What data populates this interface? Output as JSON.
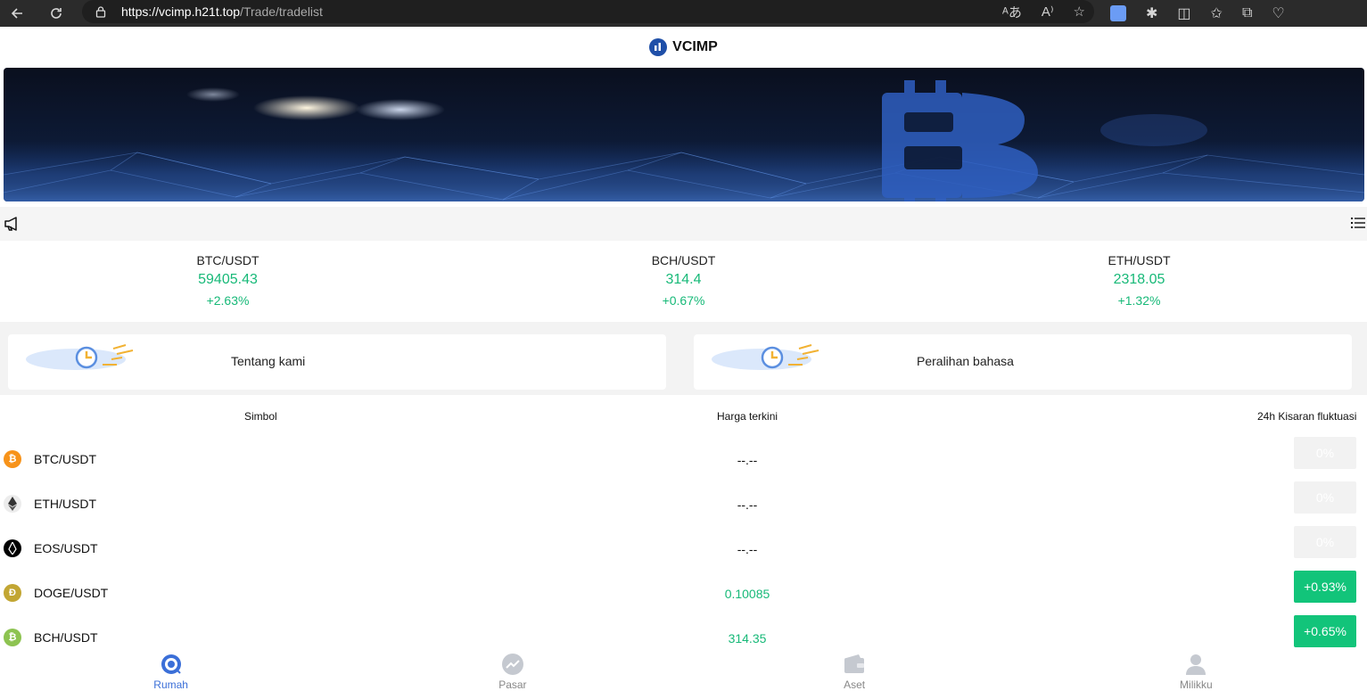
{
  "browser": {
    "url_host": "https://vcimp.h21t.top",
    "url_path": "/Trade/tradelist"
  },
  "header": {
    "title": "VCIMP"
  },
  "ticker": [
    {
      "pair": "BTC/USDT",
      "price": "59405.43",
      "change": "+2.63%"
    },
    {
      "pair": "BCH/USDT",
      "price": "314.4",
      "change": "+0.67%"
    },
    {
      "pair": "ETH/USDT",
      "price": "2318.05",
      "change": "+1.32%"
    }
  ],
  "quick_links": [
    {
      "label": "Tentang kami"
    },
    {
      "label": "Peralihan bahasa"
    }
  ],
  "table": {
    "headers": {
      "symbol": "Simbol",
      "price": "Harga terkini",
      "change": "24h Kisaran fluktuasi"
    },
    "rows": [
      {
        "symbol": "BTC/USDT",
        "price": "--.--",
        "change": "0%",
        "icon_color": "#f7931a",
        "trend": "flat"
      },
      {
        "symbol": "ETH/USDT",
        "price": "--.--",
        "change": "0%",
        "icon_color": "#e8e8e8",
        "trend": "flat"
      },
      {
        "symbol": "EOS/USDT",
        "price": "--.--",
        "change": "0%",
        "icon_color": "#000000",
        "trend": "flat"
      },
      {
        "symbol": "DOGE/USDT",
        "price": "0.10085",
        "change": "+0.93%",
        "icon_color": "#c2a633",
        "trend": "up"
      },
      {
        "symbol": "BCH/USDT",
        "price": "314.35",
        "change": "+0.65%",
        "icon_color": "#8dc351",
        "trend": "up"
      }
    ]
  },
  "bottom_nav": [
    {
      "label": "Rumah",
      "active": true
    },
    {
      "label": "Pasar",
      "active": false
    },
    {
      "label": "Aset",
      "active": false
    },
    {
      "label": "Milikku",
      "active": false
    }
  ],
  "colors": {
    "up": "#17b978",
    "badge_up": "#12c47a",
    "accent": "#3b6fd8",
    "logo": "#1f4fa8"
  }
}
